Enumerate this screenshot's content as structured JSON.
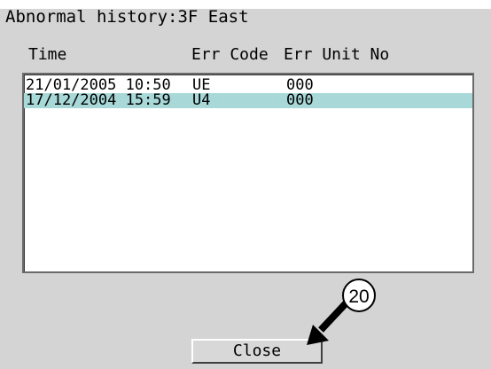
{
  "dialog": {
    "title": "Abnormal history:3F East",
    "columns": {
      "time": "Time",
      "err_code": "Err Code",
      "err_unit_no": "Err Unit No"
    },
    "rows": [
      {
        "time": "21/01/2005 10:50",
        "err_code": "UE",
        "err_unit_no": "000",
        "selected": false
      },
      {
        "time": "17/12/2004 15:59",
        "err_code": "U4",
        "err_unit_no": "000",
        "selected": true
      }
    ],
    "close_label": "Close"
  },
  "annotation": {
    "callout_number": "20",
    "icon": "arrow-pointer-icon"
  },
  "colors": {
    "panel_bg": "#d4d4d4",
    "selected_row": "#a8d8d8"
  }
}
